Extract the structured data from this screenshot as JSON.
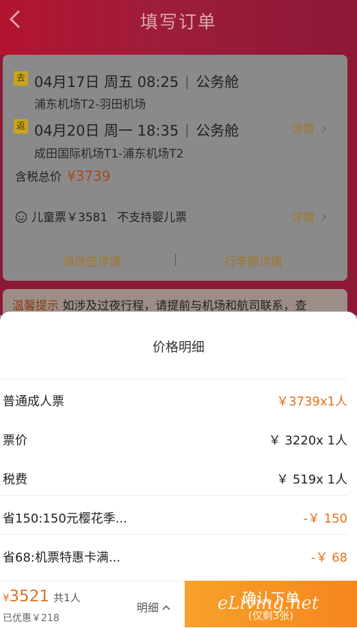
{
  "header": {
    "title": "填写订单"
  },
  "flight": {
    "outbound": {
      "badge": "去",
      "line": "04月17日 周五 08:25",
      "cabin": "公务舱",
      "route": "浦东机场T2-羽田机场"
    },
    "return": {
      "badge": "返",
      "line": "04月20日 周一 18:35",
      "cabin": "公务舱",
      "route": "成田国际机场T1-浦东机场T2"
    },
    "detail_label": "详情",
    "total_label": "含税总价",
    "total_amount": "¥3739",
    "child_ticket": "儿童票￥3581",
    "no_infant": "不支持婴儿票",
    "child_detail_label": "详情",
    "refund_link": "退改签详情",
    "baggage_link": "行李额详情"
  },
  "tip": {
    "label": "温馨提示",
    "text": " 如涉及过夜行程，请提前与机场和航司联系，查"
  },
  "sheet": {
    "title": "价格明细",
    "rows": [
      {
        "label": "普通成人票",
        "value": "￥3739x1人"
      },
      {
        "label": "票价",
        "value": "￥ 3220x 1人"
      },
      {
        "label": "税费",
        "value": "￥ 519x 1人"
      },
      {
        "label": "省150:150元樱花季...",
        "value": "-￥ 150"
      },
      {
        "label": "省68:机票特惠卡满...",
        "value": "-￥ 68"
      }
    ]
  },
  "bottom": {
    "currency": "¥",
    "amount": "3521",
    "people": "共1人",
    "saved": "已优惠￥218",
    "detail_toggle": "明细",
    "confirm": "确认下单",
    "remaining": "(仅剩3张)"
  },
  "watermark": "eLiving.net",
  "colors": {
    "accent": "#e0701f",
    "confirm": "#f7a12a",
    "header": "#b3142f"
  }
}
